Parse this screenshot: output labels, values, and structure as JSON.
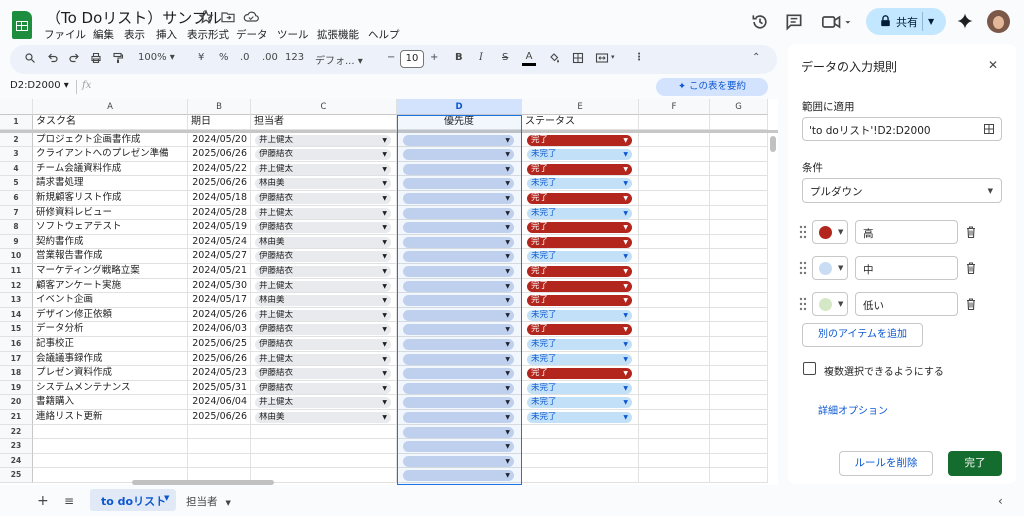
{
  "doc": {
    "title": "（To Doリスト）サンプル",
    "menus": [
      "ファイル",
      "編集",
      "表示",
      "挿入",
      "表示形式",
      "データ",
      "ツール",
      "拡張機能",
      "ヘルプ"
    ]
  },
  "header": {
    "share_label": "共有"
  },
  "toolbar": {
    "zoom": "100%",
    "currency": "¥",
    "percent": "%",
    "decimal_decrease": ".0",
    "decimal_increase": ".00",
    "number_format": "123",
    "font": "デフォ...",
    "font_size": "10"
  },
  "formula_bar": {
    "name_box": "D2:D2000",
    "fx": "fx",
    "summarize_label": "この表を要約"
  },
  "grid": {
    "columns": [
      "A",
      "B",
      "C",
      "D",
      "E",
      "F",
      "G"
    ],
    "headers": {
      "a": "タスク名",
      "b": "期日",
      "c": "担当者",
      "d": "優先度",
      "e": "ステータス"
    },
    "row_numbers": [
      "1",
      "2",
      "3",
      "4",
      "5",
      "6",
      "7",
      "8",
      "9",
      "10",
      "11",
      "12",
      "13",
      "14",
      "15",
      "16",
      "17",
      "18",
      "19",
      "20",
      "21",
      "22",
      "23",
      "24",
      "25"
    ],
    "rows": [
      {
        "task": "プロジェクト企画書作成",
        "date": "2024/05/20",
        "person": "井上健太",
        "status": "完了"
      },
      {
        "task": "クライアントへのプレゼン準備",
        "date": "2025/06/26",
        "person": "伊藤結衣",
        "status": "未完了"
      },
      {
        "task": "チーム会議資料作成",
        "date": "2024/05/22",
        "person": "井上健太",
        "status": "完了"
      },
      {
        "task": "請求書処理",
        "date": "2025/06/26",
        "person": "林由美",
        "status": "未完了"
      },
      {
        "task": "新規顧客リスト作成",
        "date": "2024/05/18",
        "person": "伊藤結衣",
        "status": "完了"
      },
      {
        "task": "研修資料レビュー",
        "date": "2024/05/28",
        "person": "井上健太",
        "status": "未完了"
      },
      {
        "task": "ソフトウェアテスト",
        "date": "2024/05/19",
        "person": "伊藤結衣",
        "status": "完了"
      },
      {
        "task": "契約書作成",
        "date": "2024/05/24",
        "person": "林由美",
        "status": "完了"
      },
      {
        "task": "営業報告書作成",
        "date": "2024/05/27",
        "person": "伊藤結衣",
        "status": "未完了"
      },
      {
        "task": "マーケティング戦略立案",
        "date": "2024/05/21",
        "person": "伊藤結衣",
        "status": "完了"
      },
      {
        "task": "顧客アンケート実施",
        "date": "2024/05/30",
        "person": "井上健太",
        "status": "完了"
      },
      {
        "task": "イベント企画",
        "date": "2024/05/17",
        "person": "林由美",
        "status": "完了"
      },
      {
        "task": "デザイン修正依頼",
        "date": "2024/05/26",
        "person": "井上健太",
        "status": "未完了"
      },
      {
        "task": "データ分析",
        "date": "2024/06/03",
        "person": "伊藤結衣",
        "status": "完了"
      },
      {
        "task": "記事校正",
        "date": "2025/06/25",
        "person": "伊藤結衣",
        "status": "未完了"
      },
      {
        "task": "会議議事録作成",
        "date": "2025/06/26",
        "person": "井上健太",
        "status": "未完了"
      },
      {
        "task": "プレゼン資料作成",
        "date": "2024/05/23",
        "person": "伊藤結衣",
        "status": "完了"
      },
      {
        "task": "システムメンテナンス",
        "date": "2025/05/31",
        "person": "伊藤結衣",
        "status": "未完了"
      },
      {
        "task": "書籍購入",
        "date": "2024/06/04",
        "person": "井上健太",
        "status": "未完了"
      },
      {
        "task": "連絡リスト更新",
        "date": "2025/06/26",
        "person": "林由美",
        "status": "未完了"
      }
    ],
    "status_colors": {
      "完了": "#b3261e",
      "未完了": "#c2e0f7"
    }
  },
  "sheets": {
    "tabs": [
      {
        "label": "to doリスト",
        "active": true
      },
      {
        "label": "担当者",
        "active": false
      }
    ]
  },
  "panel": {
    "title": "データの入力規則",
    "range_label": "範囲に適用",
    "range_value": "'to doリスト'!D2:D2000",
    "condition_label": "条件",
    "condition_value": "プルダウン",
    "options": [
      {
        "label": "高",
        "color": "#b3261e"
      },
      {
        "label": "中",
        "color": "#c8dcf3"
      },
      {
        "label": "低い",
        "color": "#d4e8c6"
      }
    ],
    "add_item_label": "別のアイテムを追加",
    "multi_select_label": "複数選択できるようにする",
    "advanced_label": "詳細オプション",
    "remove_rule_label": "ルールを削除",
    "done_label": "完了"
  }
}
